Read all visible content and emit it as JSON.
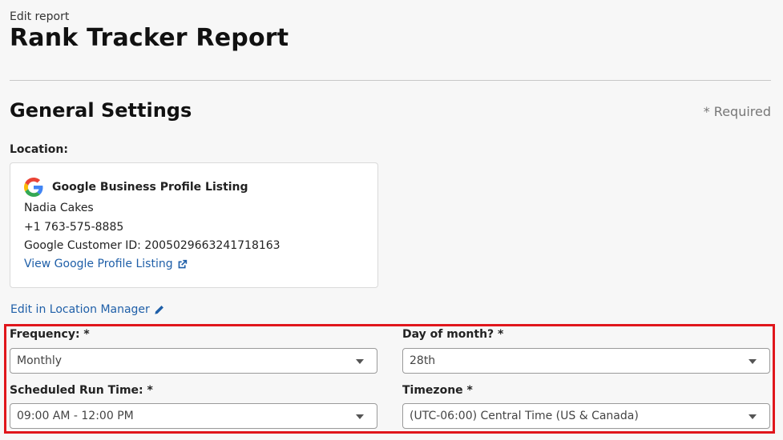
{
  "header": {
    "eyebrow": "Edit report",
    "title": "Rank Tracker Report"
  },
  "section": {
    "title": "General Settings",
    "required_note": "* Required"
  },
  "location": {
    "label": "Location:",
    "type": "Google Business Profile Listing",
    "icon": "google-g-icon",
    "name": "Nadia Cakes",
    "phone": "+1 763-575-8885",
    "customer_id": "Google Customer ID: 2005029663241718163",
    "view_link": "View Google Profile Listing",
    "view_link_icon": "external-link-icon",
    "edit_link": "Edit in Location Manager",
    "edit_link_icon": "pencil-icon"
  },
  "schedule": {
    "frequency": {
      "label": "Frequency: *",
      "value": "Monthly"
    },
    "day_of_month": {
      "label": "Day of month? *",
      "value": "28th"
    },
    "run_time": {
      "label": "Scheduled Run Time: *",
      "value": "09:00 AM - 12:00 PM"
    },
    "timezone": {
      "label": "Timezone *",
      "value": "(UTC-06:00) Central Time (US & Canada)"
    }
  },
  "colors": {
    "link": "#1f5fa8",
    "highlight": "#e0161c",
    "background": "#f7f7f7"
  }
}
